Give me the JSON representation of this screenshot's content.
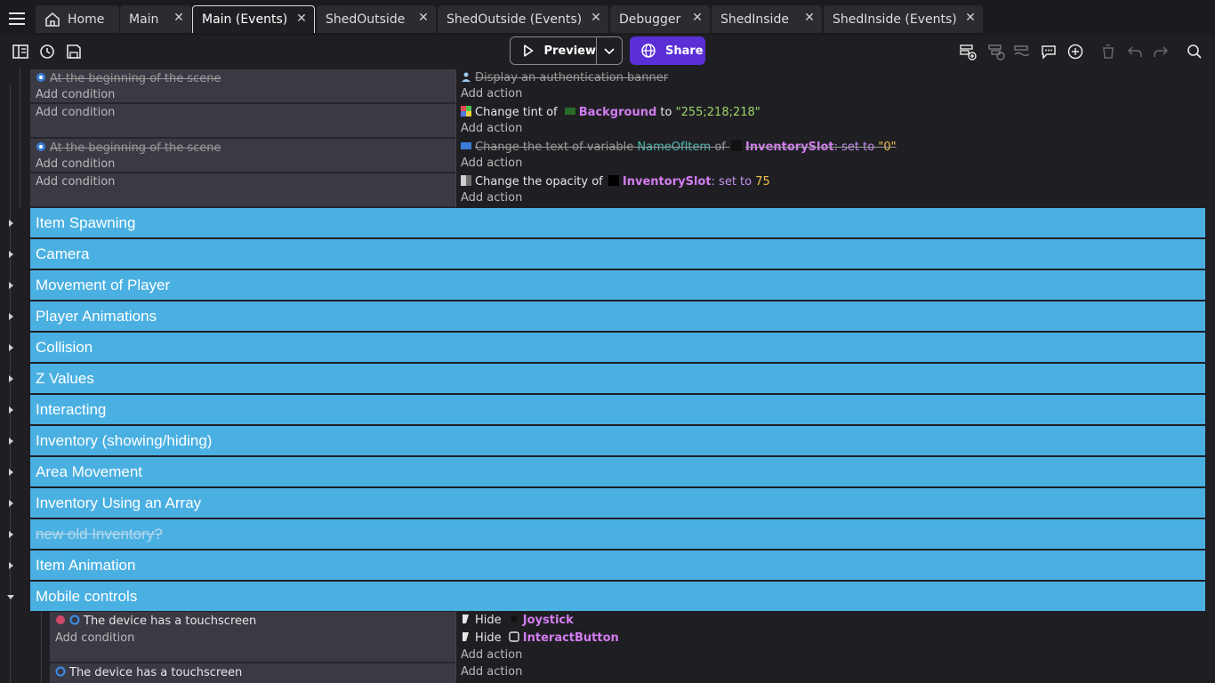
{
  "tabs": [
    {
      "label": "Home",
      "icon": "home-icon"
    },
    {
      "label": "Main"
    },
    {
      "label": "Main (Events)",
      "active": true
    },
    {
      "label": "ShedOutside"
    },
    {
      "label": "ShedOutside (Events)"
    },
    {
      "label": "Debugger"
    },
    {
      "label": "ShedInside"
    },
    {
      "label": "ShedInside (Events)"
    }
  ],
  "close_glyph": "✕",
  "toolbar": {
    "preview_label": "Preview",
    "share_label": "Share"
  },
  "events": {
    "e1": {
      "condition": "At the beginning of the scene",
      "add_condition": "Add condition",
      "action": "Display an authentication banner",
      "add_action": "Add action"
    },
    "e2": {
      "add_condition": "Add condition",
      "action_prefix": "Change tint of",
      "object": "Background",
      "action_mid": "to",
      "value": "\"255;218;218\"",
      "add_action": "Add action"
    },
    "e3": {
      "condition": "At the beginning of the scene",
      "add_condition": "Add condition",
      "action_prefix": "Change the text of variable",
      "variable": "NameOfItem",
      "action_of": "of",
      "object": "InventorySlot",
      "setto": ": set to",
      "value": "\"0\"",
      "add_action": "Add action"
    },
    "e4": {
      "add_condition": "Add condition",
      "action_prefix": "Change the opacity of",
      "object": "InventorySlot",
      "setto": ": set to",
      "value": "75",
      "add_action": "Add action"
    }
  },
  "groups": [
    {
      "label": "Item Spawning"
    },
    {
      "label": "Camera"
    },
    {
      "label": "Movement of Player"
    },
    {
      "label": "Player Animations"
    },
    {
      "label": "Collision"
    },
    {
      "label": "Z Values"
    },
    {
      "label": "Interacting"
    },
    {
      "label": "Inventory (showing/hiding)"
    },
    {
      "label": "Area Movement"
    },
    {
      "label": "Inventory Using an Array"
    },
    {
      "label": "new old Inventory?",
      "disabled": true
    },
    {
      "label": "Item Animation"
    },
    {
      "label": "Mobile controls",
      "expanded": true
    }
  ],
  "mobile": {
    "m1": {
      "condition": "The device has a touchscreen",
      "add_condition": "Add condition",
      "hide_label": "Hide",
      "object1": "Joystick",
      "object2": "InteractButton",
      "add_action": "Add action"
    },
    "m2": {
      "condition": "The device has a touchscreen",
      "add_action": "Add action"
    }
  },
  "colors": {
    "group": "#4ab0e2",
    "share": "#5b2fd6",
    "object": "#d27cf0"
  }
}
